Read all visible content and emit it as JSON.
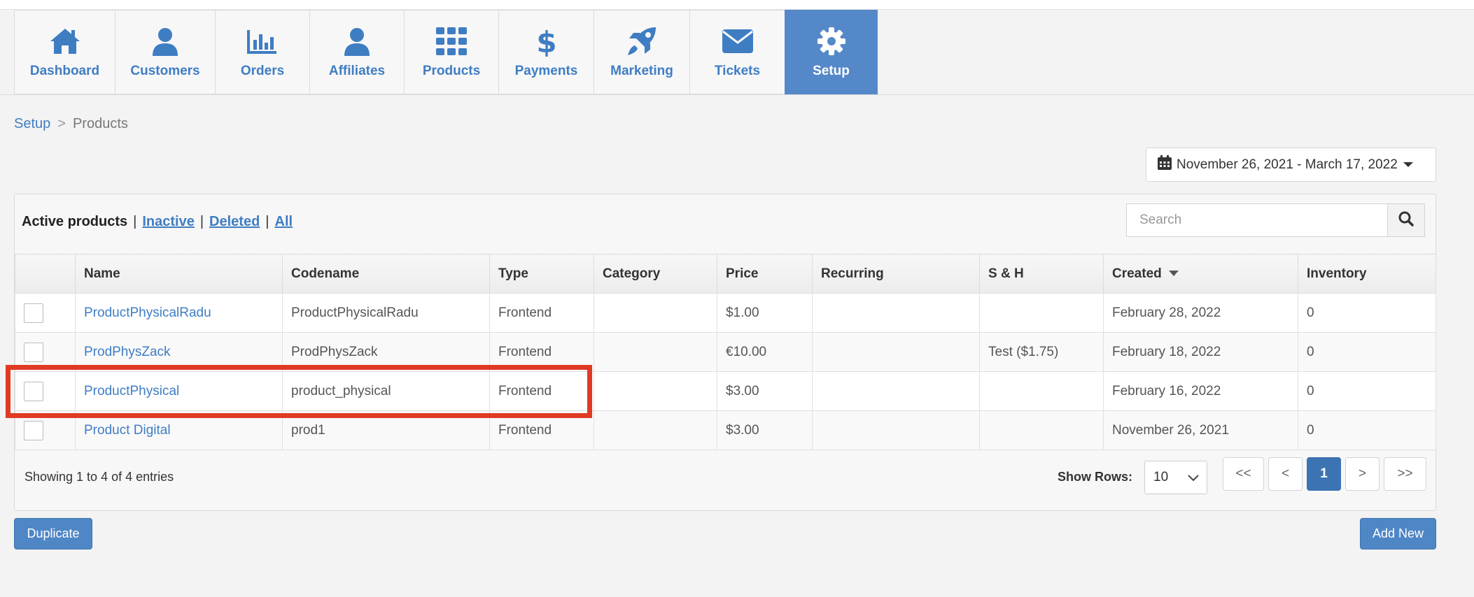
{
  "nav": {
    "tabs": [
      {
        "label": "Dashboard",
        "icon": "home-icon",
        "active": false
      },
      {
        "label": "Customers",
        "icon": "user-icon",
        "active": false
      },
      {
        "label": "Orders",
        "icon": "bar-chart-icon",
        "active": false
      },
      {
        "label": "Affiliates",
        "icon": "user-icon",
        "active": false
      },
      {
        "label": "Products",
        "icon": "grid-icon",
        "active": false
      },
      {
        "label": "Payments",
        "icon": "dollar-icon",
        "active": false
      },
      {
        "label": "Marketing",
        "icon": "rocket-icon",
        "active": false
      },
      {
        "label": "Tickets",
        "icon": "envelope-icon",
        "active": false
      },
      {
        "label": "Setup",
        "icon": "gear-icon",
        "active": true
      }
    ],
    "active_color": "#5588c8",
    "link_color": "#3f7dc3"
  },
  "breadcrumb": {
    "parent": "Setup",
    "separator": ">",
    "current": "Products"
  },
  "date_range": {
    "label": "November 26, 2021 - March 17, 2022",
    "icon": "calendar-icon"
  },
  "filters": {
    "active": "Active products",
    "separator": "|",
    "inactive": "Inactive",
    "deleted": "Deleted",
    "all": "All"
  },
  "search": {
    "placeholder": "Search",
    "value": "",
    "icon": "search-icon"
  },
  "table": {
    "columns": [
      "Name",
      "Codename",
      "Type",
      "Category",
      "Price",
      "Recurring",
      "S & H",
      "Created",
      "Inventory"
    ],
    "sorted_column": "Created",
    "rows": [
      {
        "name": "ProductPhysicalRadu",
        "codename": "ProductPhysicalRadu",
        "type": "Frontend",
        "category": "",
        "price": "$1.00",
        "recurring": "",
        "sh": "",
        "created": "February 28, 2022",
        "inventory": "0"
      },
      {
        "name": "ProdPhysZack",
        "codename": "ProdPhysZack",
        "type": "Frontend",
        "category": "",
        "price": "€10.00",
        "recurring": "",
        "sh": "Test ($1.75)",
        "created": "February 18, 2022",
        "inventory": "0"
      },
      {
        "name": "ProductPhysical",
        "codename": "product_physical",
        "type": "Frontend",
        "category": "",
        "price": "$3.00",
        "recurring": "",
        "sh": "",
        "created": "February 16, 2022",
        "inventory": "0"
      },
      {
        "name": "Product Digital",
        "codename": "prod1",
        "type": "Frontend",
        "category": "",
        "price": "$3.00",
        "recurring": "",
        "sh": "",
        "created": "November 26, 2021",
        "inventory": "0"
      }
    ]
  },
  "footer": {
    "entries": "Showing 1 to 4 of 4 entries",
    "show_rows_label": "Show Rows:",
    "show_rows_value": "10",
    "pager": {
      "first": "<<",
      "prev": "<",
      "current": "1",
      "next": ">",
      "last": ">>"
    }
  },
  "actions": {
    "duplicate": "Duplicate",
    "add_new": "Add New"
  },
  "highlight_color": "#e03a24"
}
